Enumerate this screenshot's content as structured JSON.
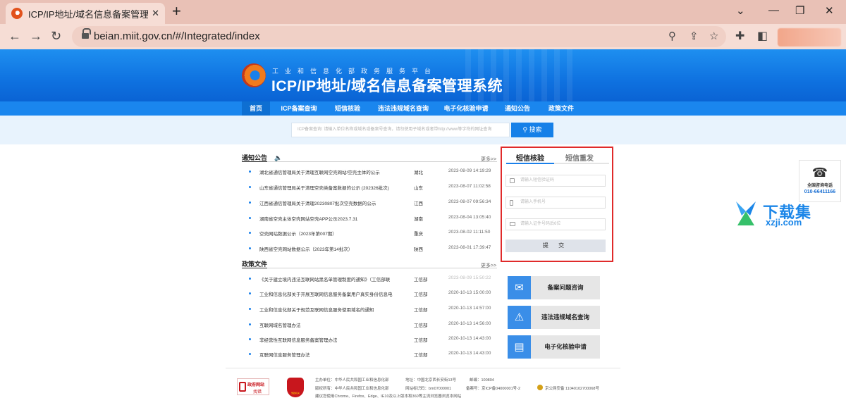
{
  "browser": {
    "tab_title": "ICP/IP地址/域名信息备案管理系统",
    "tab_close": "✕",
    "new_tab": "+",
    "url": "beian.miit.gov.cn/#/Integrated/index",
    "window_controls": [
      "⌄",
      "—",
      "❐",
      "✕"
    ]
  },
  "header": {
    "subtitle": "工业和信息化部政务服务平台",
    "title": "ICP/IP地址/域名信息备案管理系统"
  },
  "nav": {
    "items": [
      "首页",
      "ICP备案查询",
      "短信核验",
      "违法违规域名查询",
      "电子化核验申请",
      "通知公告",
      "政策文件"
    ]
  },
  "search": {
    "placeholder": "ICP备案查询: 请输入单位名称或域名或备案号查询，请勿使用子域名或者带http://www等字符的网址查询",
    "button": "搜索"
  },
  "notices": {
    "title": "通知公告",
    "more": "更多>>",
    "rows": [
      {
        "title": "湖北省通信管理局关于清理互联网空壳网站/空壳主体的公示",
        "region": "湖北",
        "date": "2023-08-09 14:19:29"
      },
      {
        "title": "山东省通信管理局关于清理空壳类备案数据的公示 (202326批次)",
        "region": "山东",
        "date": "2023-08-07 11:02:58"
      },
      {
        "title": "江西省通信管理局关于清理20230807批次空壳数据的公示",
        "region": "江西",
        "date": "2023-08-07 09:56:34"
      },
      {
        "title": "湖南省空壳主体空壳网站空壳APP公示2023.7.31",
        "region": "湖南",
        "date": "2023-08-04 13:05:40"
      },
      {
        "title": "空壳网站数据公示（2023年第007期）",
        "region": "重庆",
        "date": "2023-08-02 11:11:50"
      },
      {
        "title": "陕西省空壳网站数据公示（2023年第14批次）",
        "region": "陕西",
        "date": "2023-08-01 17:39:47"
      }
    ]
  },
  "policies": {
    "title": "政策文件",
    "more": "更多>>",
    "rows": [
      {
        "title": "《关于建立境内违法互联网站黑名单管理制度的通知》（工信部联",
        "region": "工信部",
        "date": "2023-08-09 15:50:22"
      },
      {
        "title": "工业和信息化部关于开展互联网信息服务备案用户真实身份信息电",
        "region": "工信部",
        "date": "2020-10-13 15:00:00"
      },
      {
        "title": "工业和信息化部关于规范互联网信息服务使用域名的通知",
        "region": "工信部",
        "date": "2020-10-13 14:57:00"
      },
      {
        "title": "互联网域名管理办法",
        "region": "工信部",
        "date": "2020-10-13 14:56:00"
      },
      {
        "title": "非经营性互联网信息服务备案管理办法",
        "region": "工信部",
        "date": "2020-10-13 14:43:00"
      },
      {
        "title": "互联网信息服务管理办法",
        "region": "工信部",
        "date": "2020-10-13 14:43:00"
      }
    ]
  },
  "sms": {
    "tab_verify": "短信核验",
    "tab_resend": "短信重发",
    "field_code": "请输入短信验证码",
    "field_phone": "请输入手机号",
    "field_id": "请输入证件号码后6位",
    "submit": "提 交"
  },
  "services": [
    {
      "label": "备案问题咨询",
      "icon": "consult-icon"
    },
    {
      "label": "违法违规域名查询",
      "icon": "warning-icon"
    },
    {
      "label": "电子化核验申请",
      "icon": "id-card-icon"
    }
  ],
  "hotline": {
    "label": "全国咨询电话",
    "number": "010-66411166"
  },
  "watermark": {
    "name": "下载集",
    "url": "xzji.com"
  },
  "footer": {
    "gov_badge_1": "政府网站",
    "gov_badge_2": "找错",
    "seal_text": "党政机关",
    "line1_sponsor": "主办单位：中华人民共和国工业和信息化部",
    "line1_address": "地址：中国北京西长安街13号",
    "line1_postcode": "邮编：100804",
    "line2_copyright": "版权所有：中华人民共和国工业和信息化部",
    "line2_site_id": "网站标识码：bm07000001",
    "line2_icp": "备案号：京ICP备04000001号-2",
    "line2_police": "京公网安备 11040102700068号",
    "line3": "建议您使用Chrome、Firefox、Edge、IE10及以上版本和360等主流浏览器浏览本网站"
  },
  "colors": {
    "brand_blue": "#1a86ee",
    "highlight_red": "#e02a2a",
    "tab_bg": "#e9c1b6"
  }
}
